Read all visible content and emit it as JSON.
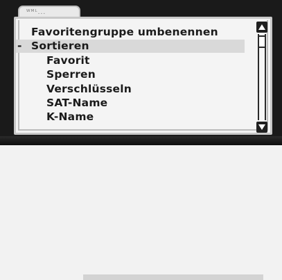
{
  "tab": {
    "label": "ᵂᴹᴸ..."
  },
  "menu": {
    "items": [
      {
        "label": "Favoritengruppe umbenennen",
        "level": 1
      },
      {
        "label": "Sortieren",
        "level": 1,
        "expanded": true,
        "selected": true,
        "marker": "-"
      },
      {
        "label": "Favorit",
        "level": 2
      },
      {
        "label": "Sperren",
        "level": 2
      },
      {
        "label": "Verschlüsseln",
        "level": 2
      },
      {
        "label": "SAT-Name",
        "level": 2
      },
      {
        "label": "K-Name",
        "level": 2
      }
    ]
  },
  "scrollbar": {
    "up_icon": "triangle-up-icon",
    "down_icon": "triangle-down-icon",
    "position": 0.05
  },
  "colors": {
    "panel_bg": "#f4f4f4",
    "selected_row_bg": "#d9d9d9",
    "text": "#1b1b1b",
    "scroll_button": "#1f1f1f"
  }
}
